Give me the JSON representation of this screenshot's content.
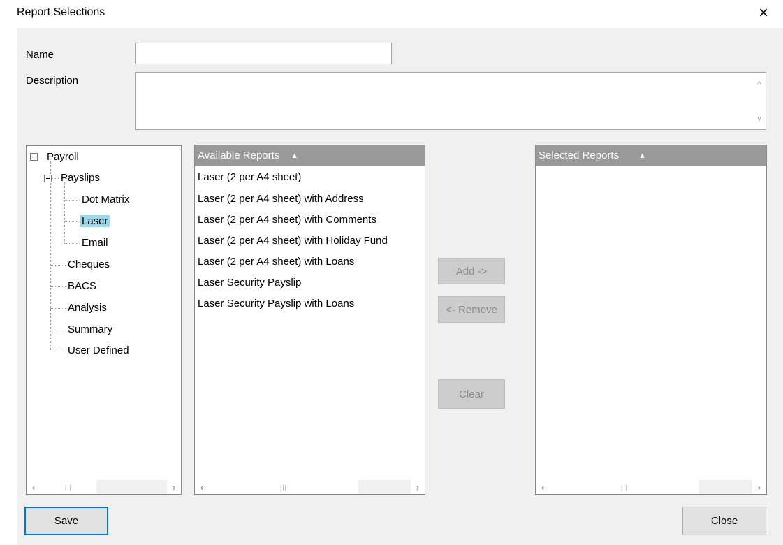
{
  "window": {
    "title": "Report Selections",
    "close_glyph": "×"
  },
  "form": {
    "name_label": "Name",
    "name_value": "",
    "description_label": "Description",
    "description_value": ""
  },
  "tree": {
    "root": "Payroll",
    "payslips": "Payslips",
    "payslip_children": [
      "Dot Matrix",
      "Laser",
      "Email"
    ],
    "selected": "Laser",
    "others": [
      "Cheques",
      "BACS",
      "Analysis",
      "Summary",
      "User Defined"
    ]
  },
  "available": {
    "header": "Available Reports",
    "sort_glyph": "▲",
    "items": [
      "Laser (2 per A4 sheet)",
      "Laser (2 per A4 sheet) with Address",
      "Laser (2 per A4 sheet) with Comments",
      "Laser (2 per A4 sheet) with Holiday Fund",
      "Laser (2 per A4 sheet) with Loans",
      "Laser Security Payslip",
      "Laser Security Payslip with Loans"
    ]
  },
  "selected_reports": {
    "header": "Selected Reports",
    "sort_glyph": "▲",
    "items": []
  },
  "buttons": {
    "add": "Add ->",
    "remove": "<- Remove",
    "clear": "Clear",
    "save": "Save",
    "close": "Close"
  },
  "icons": {
    "arrow_left": "‹",
    "arrow_right": "›",
    "arrow_up": "^",
    "arrow_down": "v",
    "grip": "|||"
  },
  "colors": {
    "header_bg": "#999999",
    "selection_bg": "#99d9ea",
    "default_button_border": "#0078d7"
  }
}
